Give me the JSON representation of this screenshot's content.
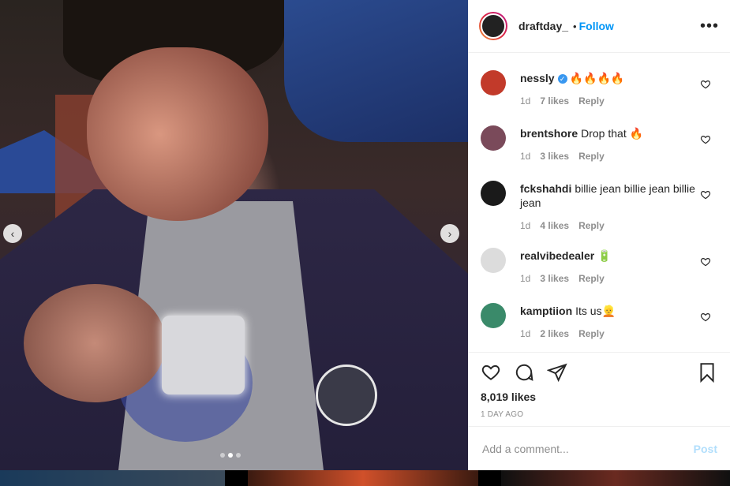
{
  "post": {
    "username": "draftday_",
    "separator": "•",
    "follow_label": "Follow",
    "more_icon": "more-options-icon",
    "likes": "8,019 likes",
    "date": "1 DAY AGO",
    "carousel": {
      "current": 2,
      "total": 3
    }
  },
  "comments": [
    {
      "user": "nessly",
      "verified": true,
      "text": "🔥🔥🔥🔥",
      "time": "1d",
      "likes": "7 likes",
      "reply": "Reply",
      "avatar_color": "#c23a2a"
    },
    {
      "user": "brentshore",
      "verified": false,
      "text": "Drop that 🔥",
      "time": "1d",
      "likes": "3 likes",
      "reply": "Reply",
      "avatar_color": "#7a4a5a"
    },
    {
      "user": "fckshahdi",
      "verified": false,
      "text": "billie jean billie jean billie jean",
      "time": "1d",
      "likes": "4 likes",
      "reply": "Reply",
      "avatar_color": "#1a1a1a"
    },
    {
      "user": "realvibedealer",
      "verified": false,
      "text": "🔋",
      "time": "1d",
      "likes": "3 likes",
      "reply": "Reply",
      "avatar_color": "#dcdcdc"
    },
    {
      "user": "kamptiion",
      "verified": false,
      "text": "Its us👱",
      "time": "1d",
      "likes": "2 likes",
      "reply": "Reply",
      "avatar_color": "#3a8a6a"
    }
  ],
  "composer": {
    "placeholder": "Add a comment...",
    "post_label": "Post"
  },
  "nav": {
    "prev": "‹",
    "next": "›"
  },
  "colors": {
    "accent": "#0095f6",
    "text": "#262626",
    "muted": "#8e8e8e"
  }
}
